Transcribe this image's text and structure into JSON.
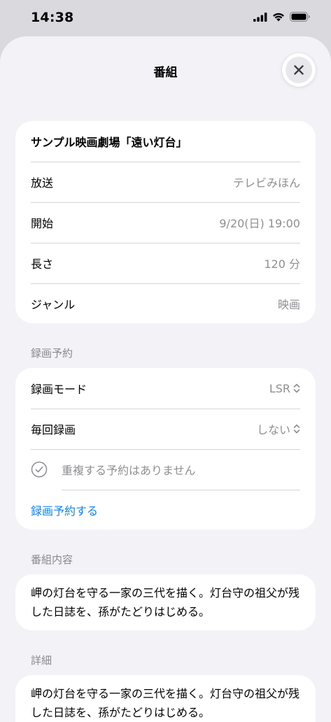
{
  "status": {
    "time": "14:38"
  },
  "sheet": {
    "title": "番組"
  },
  "program": {
    "title": "サンプル映画劇場「遠い灯台」",
    "rows": [
      {
        "label": "放送",
        "value": "テレビみほん"
      },
      {
        "label": "開始",
        "value": "9/20(日) 19:00"
      },
      {
        "label": "長さ",
        "value": "120 分"
      },
      {
        "label": "ジャンル",
        "value": "映画"
      }
    ]
  },
  "recording": {
    "header": "録画予約",
    "mode_label": "録画モード",
    "mode_value": "LSR",
    "repeat_label": "毎回録画",
    "repeat_value": "しない",
    "duplicate_text": "重複する予約はありません",
    "reserve_label": "録画予約する"
  },
  "content": {
    "header": "番組内容",
    "text": "岬の灯台を守る一家の三代を描く。灯台守の祖父が残した日誌を、孫がたどりはじめる。"
  },
  "details": {
    "header": "詳細",
    "text": "岬の灯台を守る一家の三代を描く。灯台守の祖父が残した日誌を、孫がたどりはじめる。"
  },
  "colors": {
    "accent": "#0a84ff",
    "secondary_text": "#8e8e93",
    "background": "#f2f2f7"
  }
}
